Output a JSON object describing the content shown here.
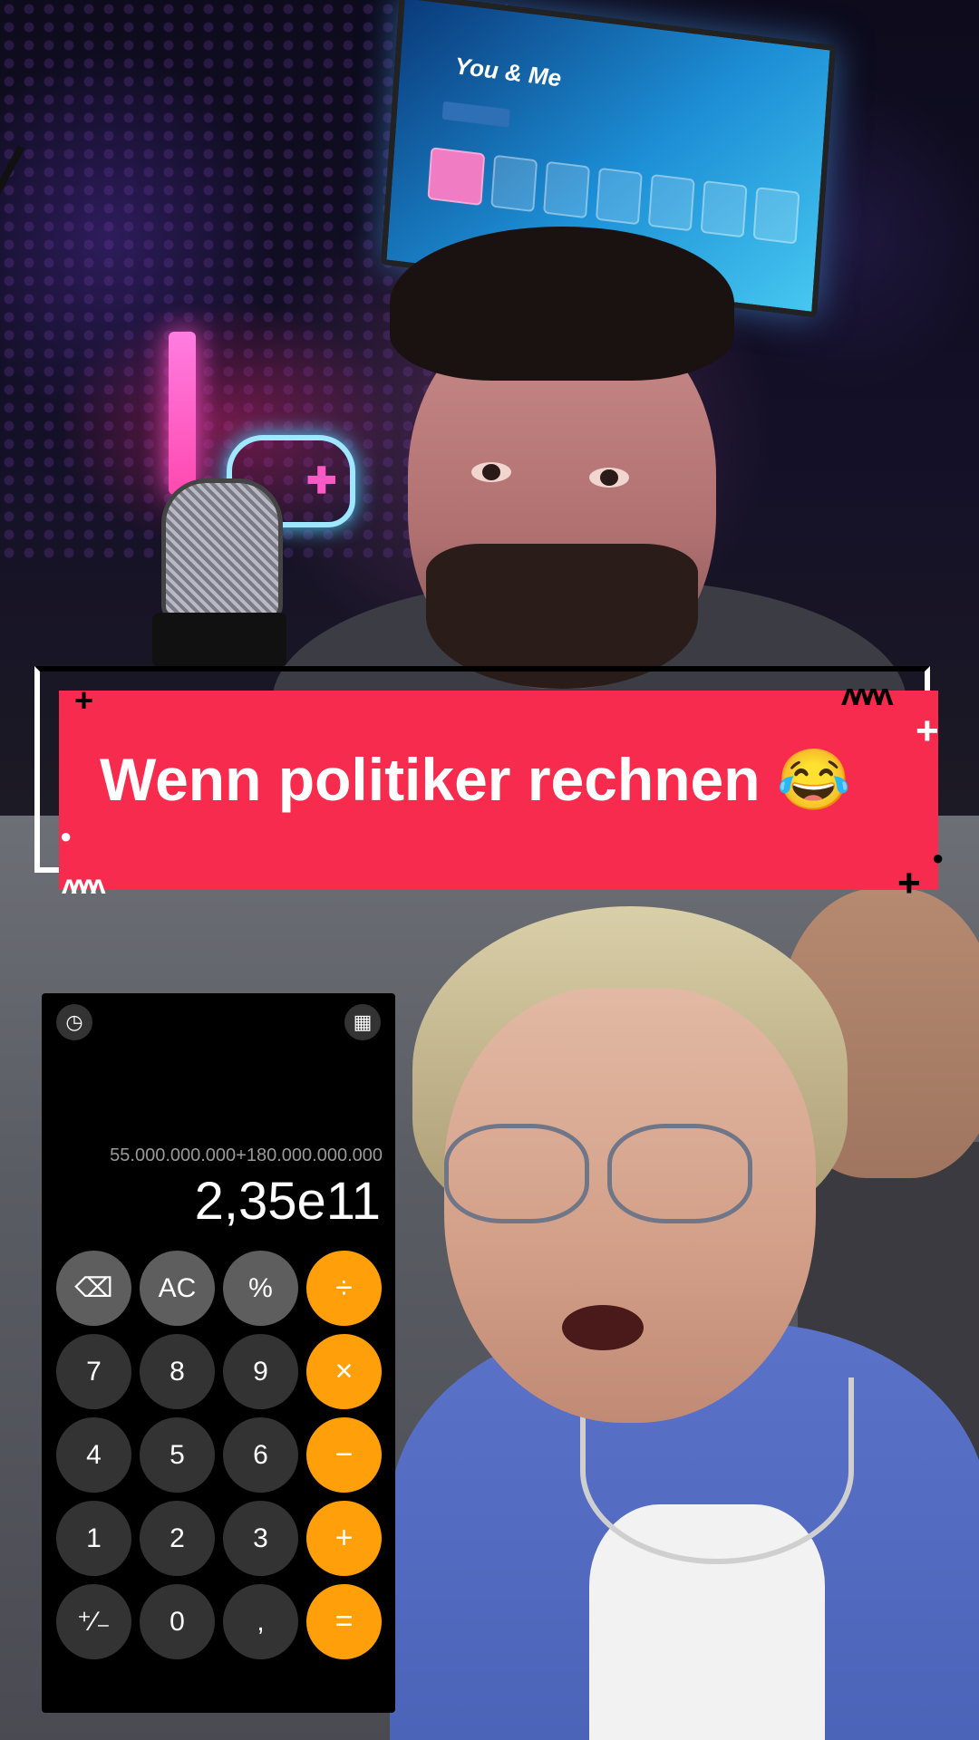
{
  "caption": {
    "text": "Wenn politiker rechnen 😂",
    "background_color": "#f62b4d",
    "text_color": "#ffffff"
  },
  "monitor": {
    "title": "You & Me"
  },
  "calculator": {
    "top_icons": [
      "history-icon",
      "calculator-icon"
    ],
    "expression": "55.000.000.000+180.000.000.000",
    "result": "2,35e11",
    "keys": [
      {
        "label": "⌫",
        "type": "function",
        "icon": "backspace-icon"
      },
      {
        "label": "AC",
        "type": "function"
      },
      {
        "label": "%",
        "type": "function"
      },
      {
        "label": "÷",
        "type": "operator"
      },
      {
        "label": "7",
        "type": "digit"
      },
      {
        "label": "8",
        "type": "digit"
      },
      {
        "label": "9",
        "type": "digit"
      },
      {
        "label": "×",
        "type": "operator"
      },
      {
        "label": "4",
        "type": "digit"
      },
      {
        "label": "5",
        "type": "digit"
      },
      {
        "label": "6",
        "type": "digit"
      },
      {
        "label": "−",
        "type": "operator"
      },
      {
        "label": "1",
        "type": "digit"
      },
      {
        "label": "2",
        "type": "digit"
      },
      {
        "label": "3",
        "type": "digit"
      },
      {
        "label": "+",
        "type": "operator"
      },
      {
        "label": "⁺∕₋",
        "type": "digit"
      },
      {
        "label": "0",
        "type": "digit"
      },
      {
        "label": ",",
        "type": "digit"
      },
      {
        "label": "=",
        "type": "operator"
      }
    ],
    "operator_color": "#ff9f0a",
    "key_color": "#333333"
  }
}
